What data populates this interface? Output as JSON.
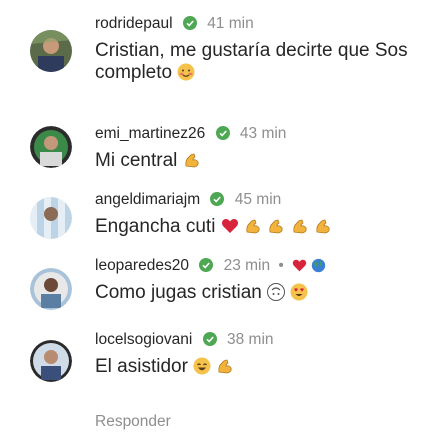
{
  "comments": [
    {
      "user": "rodridepaul",
      "time": "41 min",
      "text_line1": "Cristian, me gustaría decirte que Sos",
      "text_line2": "completo",
      "text_emoji": "blushing-face"
    },
    {
      "user": "emi_martinez26",
      "time": "43 min",
      "text": "Mi central",
      "text_emoji": "flexed-biceps"
    },
    {
      "user": "angeldimariajm",
      "time": "45 min",
      "text": "Engancha cuti",
      "text_emojis": [
        "heart",
        "flexed-biceps",
        "flexed-biceps",
        "flexed-biceps",
        "flexed-biceps"
      ]
    },
    {
      "user": "leoparedes20",
      "time": "23 min",
      "meta_emojis": [
        "heart",
        "globe"
      ],
      "text": "Como jugas cristian",
      "text_emojis": [
        "upside-down-face",
        "heart-eyes-face"
      ]
    },
    {
      "user": "locelsogiovani",
      "time": "38 min",
      "text": "El asistidor",
      "text_emojis": [
        "grinning-face",
        "flexed-biceps"
      ]
    }
  ],
  "reply_label": "Responder",
  "colors": {
    "verified": "#4ea853",
    "muted": "#8e8e8e",
    "text": "#262626"
  }
}
